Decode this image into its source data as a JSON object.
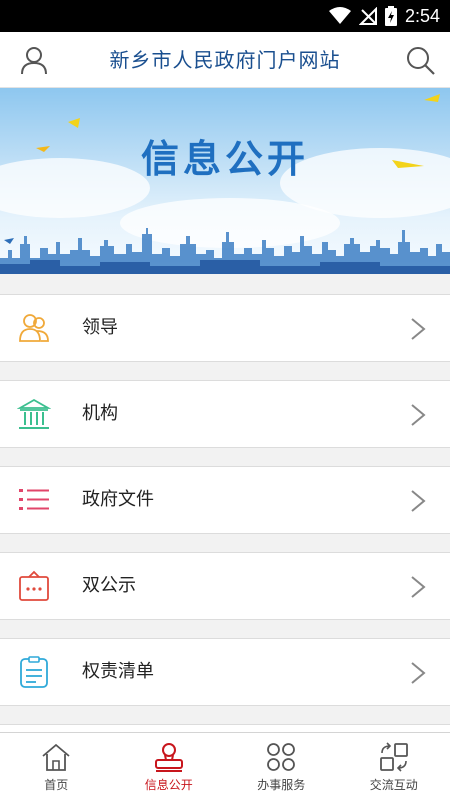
{
  "status_bar": {
    "time": "2:54"
  },
  "header": {
    "title": "新乡市人民政府门户网站"
  },
  "banner": {
    "title": "信息公开"
  },
  "menu": {
    "items": [
      {
        "label": "领导",
        "icon": "leaders-icon",
        "color": "#f0a93a"
      },
      {
        "label": "机构",
        "icon": "institution-icon",
        "color": "#3bbf8f"
      },
      {
        "label": "政府文件",
        "icon": "document-list-icon",
        "color": "#e1456a"
      },
      {
        "label": "双公示",
        "icon": "public-notice-icon",
        "color": "#e04a3c"
      },
      {
        "label": "权责清单",
        "icon": "responsibility-list-icon",
        "color": "#2fa9d9"
      }
    ]
  },
  "tabbar": {
    "tabs": [
      {
        "label": "首页",
        "icon": "home-icon",
        "active": false
      },
      {
        "label": "信息公开",
        "icon": "info-public-icon",
        "active": true
      },
      {
        "label": "办事服务",
        "icon": "services-icon",
        "active": false
      },
      {
        "label": "交流互动",
        "icon": "interaction-icon",
        "active": false
      }
    ]
  },
  "colors": {
    "accent": "#c8161d",
    "title": "#1a4f8f",
    "banner_title": "#1f6fc0"
  }
}
